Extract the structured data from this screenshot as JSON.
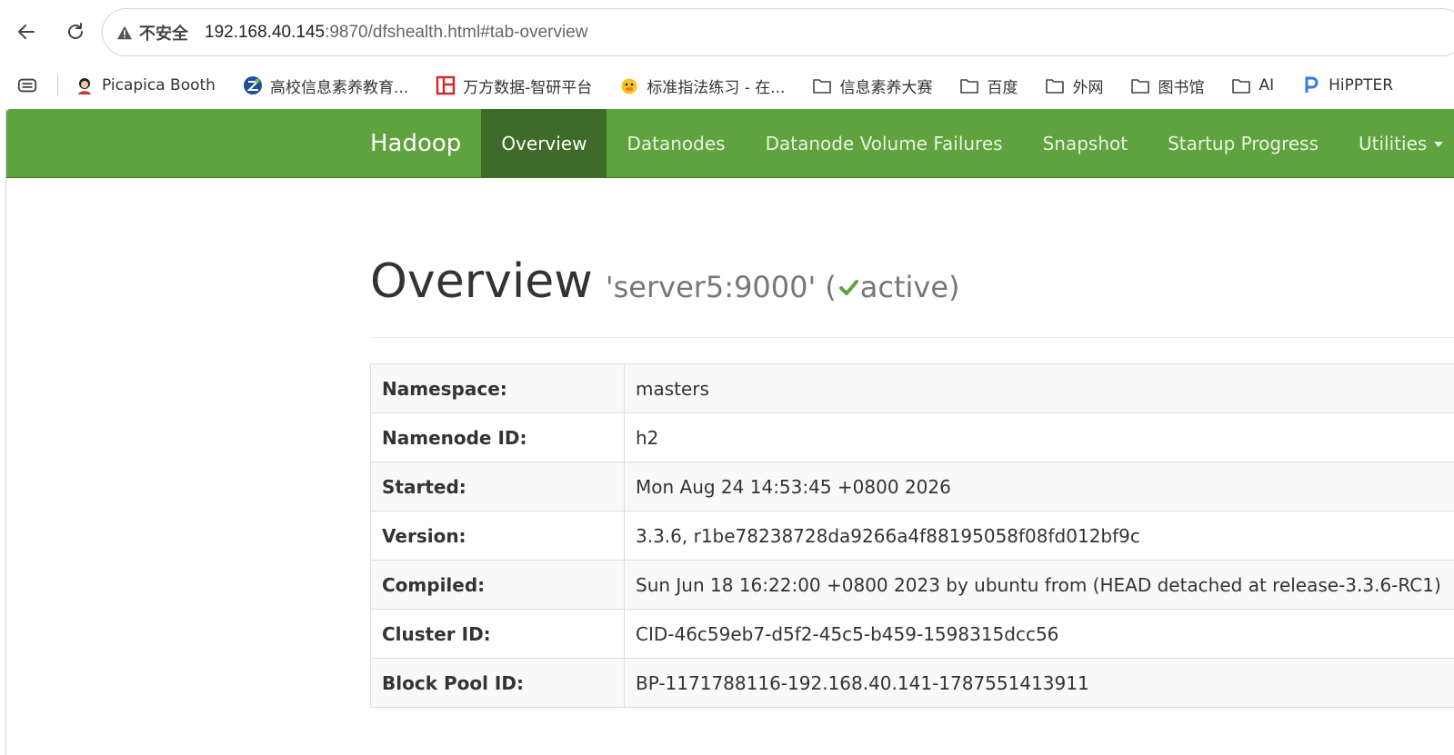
{
  "browser": {
    "insecure_label": "不安全",
    "url_host": "192.168.40.145",
    "url_path": ":9870/dfshealth.html#tab-overview",
    "bookmarks": [
      {
        "label": "Picapica Booth",
        "icon": "avatar-icon"
      },
      {
        "label": "高校信息素养教育...",
        "icon": "z-logo-icon"
      },
      {
        "label": "万方数据-智研平台",
        "icon": "wanfang-logo-icon"
      },
      {
        "label": "标准指法练习 - 在...",
        "icon": "duck-icon"
      },
      {
        "label": "信息素养大赛",
        "icon": "folder-icon"
      },
      {
        "label": "百度",
        "icon": "folder-icon"
      },
      {
        "label": "外网",
        "icon": "folder-icon"
      },
      {
        "label": "图书馆",
        "icon": "folder-icon"
      },
      {
        "label": "AI",
        "icon": "folder-icon"
      },
      {
        "label": "HiPPTER",
        "icon": "p-logo-icon"
      }
    ]
  },
  "navbar": {
    "brand": "Hadoop",
    "items": [
      {
        "label": "Overview",
        "active": true
      },
      {
        "label": "Datanodes"
      },
      {
        "label": "Datanode Volume Failures"
      },
      {
        "label": "Snapshot"
      },
      {
        "label": "Startup Progress"
      },
      {
        "label": "Utilities"
      }
    ],
    "color": "#5fa33e",
    "active_color": "#3f6b2a"
  },
  "header": {
    "title": "Overview",
    "subtitle": "'server5:9000'",
    "paren_open": "(",
    "status": "active",
    "paren_close": ")",
    "status_color": "#5fa33e"
  },
  "overview_table": [
    {
      "key": "Namespace:",
      "value": "masters"
    },
    {
      "key": "Namenode ID:",
      "value": "h2"
    },
    {
      "key": "Started:",
      "value": "Mon Aug 24 14:53:45 +0800 2026"
    },
    {
      "key": "Version:",
      "value": "3.3.6, r1be78238728da9266a4f88195058f08fd012bf9c"
    },
    {
      "key": "Compiled:",
      "value": "Sun Jun 18 16:22:00 +0800 2023 by ubuntu from (HEAD detached at release-3.3.6-RC1)"
    },
    {
      "key": "Cluster ID:",
      "value": "CID-46c59eb7-d5f2-45c5-b459-1598315dcc56"
    },
    {
      "key": "Block Pool ID:",
      "value": "BP-1171788116-192.168.40.141-1787551413911"
    }
  ]
}
